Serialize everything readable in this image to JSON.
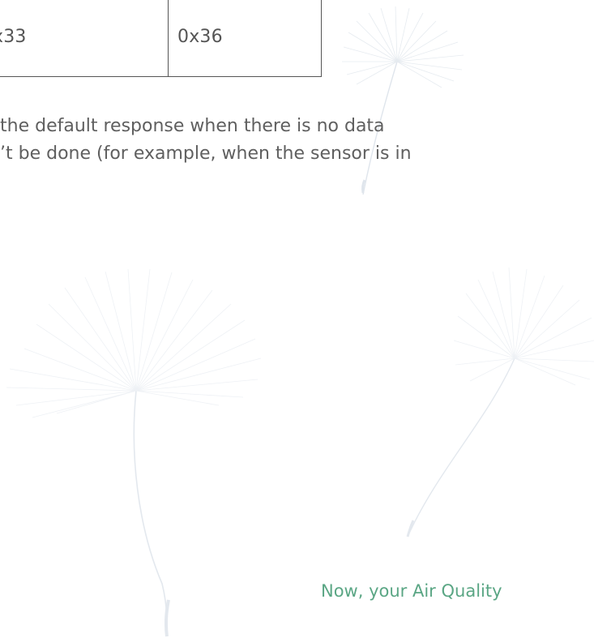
{
  "table": {
    "cell_left": "x33",
    "cell_right": "0x36"
  },
  "paragraph": {
    "line1": "the default response when there is no data",
    "line2": "’t be done (for example, when the sensor is in"
  },
  "footer": {
    "tagline": "Now, your Air Quality"
  },
  "colors": {
    "text": "#5f5f5f",
    "border": "#555555",
    "tagline": "#5aa684",
    "decor": "#e3e8ee"
  },
  "decor_icons": [
    "dandelion-icon",
    "dandelion-icon",
    "dandelion-icon"
  ]
}
